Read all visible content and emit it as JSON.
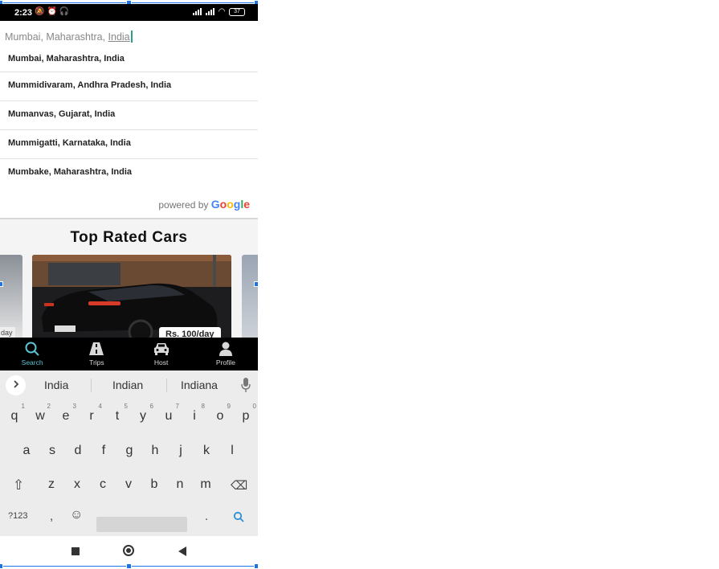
{
  "status_bar": {
    "time": "2:23",
    "battery": "37"
  },
  "search": {
    "value_prefix": "Mumbai, Maharashtra, ",
    "value_underlined": "India"
  },
  "suggestions": [
    "Mumbai, Maharashtra, India",
    "Mummidivaram, Andhra Pradesh, India",
    "Mumanvas, Gujarat, India",
    "Mummigatti, Karnataka, India",
    "Mumbake, Maharashtra, India"
  ],
  "powered_by": {
    "prefix": "powered by",
    "brand": "Google",
    "brand_colors": [
      "#4285F4",
      "#EA4335",
      "#FBBC05",
      "#4285F4",
      "#34A853",
      "#EA4335"
    ]
  },
  "top_rated": {
    "title": "Top Rated Cars",
    "price": "Rs. 100/day",
    "left_tag": "day"
  },
  "bottom_nav": [
    {
      "label": "Search",
      "icon": "search-icon",
      "active": true
    },
    {
      "label": "Trips",
      "icon": "road-icon"
    },
    {
      "label": "Host",
      "icon": "car-icon"
    },
    {
      "label": "Profile",
      "icon": "person-icon"
    }
  ],
  "keyboard": {
    "suggestions": [
      "India",
      "Indian",
      "Indiana"
    ],
    "row1": [
      "q",
      "w",
      "e",
      "r",
      "t",
      "y",
      "u",
      "i",
      "o",
      "p"
    ],
    "row1_nums": [
      "1",
      "2",
      "3",
      "4",
      "5",
      "6",
      "7",
      "8",
      "9",
      "0"
    ],
    "row2": [
      "a",
      "s",
      "d",
      "f",
      "g",
      "h",
      "j",
      "k",
      "l"
    ],
    "row3": [
      "z",
      "x",
      "c",
      "v",
      "b",
      "n",
      "m"
    ],
    "symbols_key": "?123",
    "comma": ",",
    "period": "."
  },
  "colors": {
    "accent": "#5ec2d4",
    "caret": "#2a9d8f",
    "selection": "#1a73e8"
  }
}
